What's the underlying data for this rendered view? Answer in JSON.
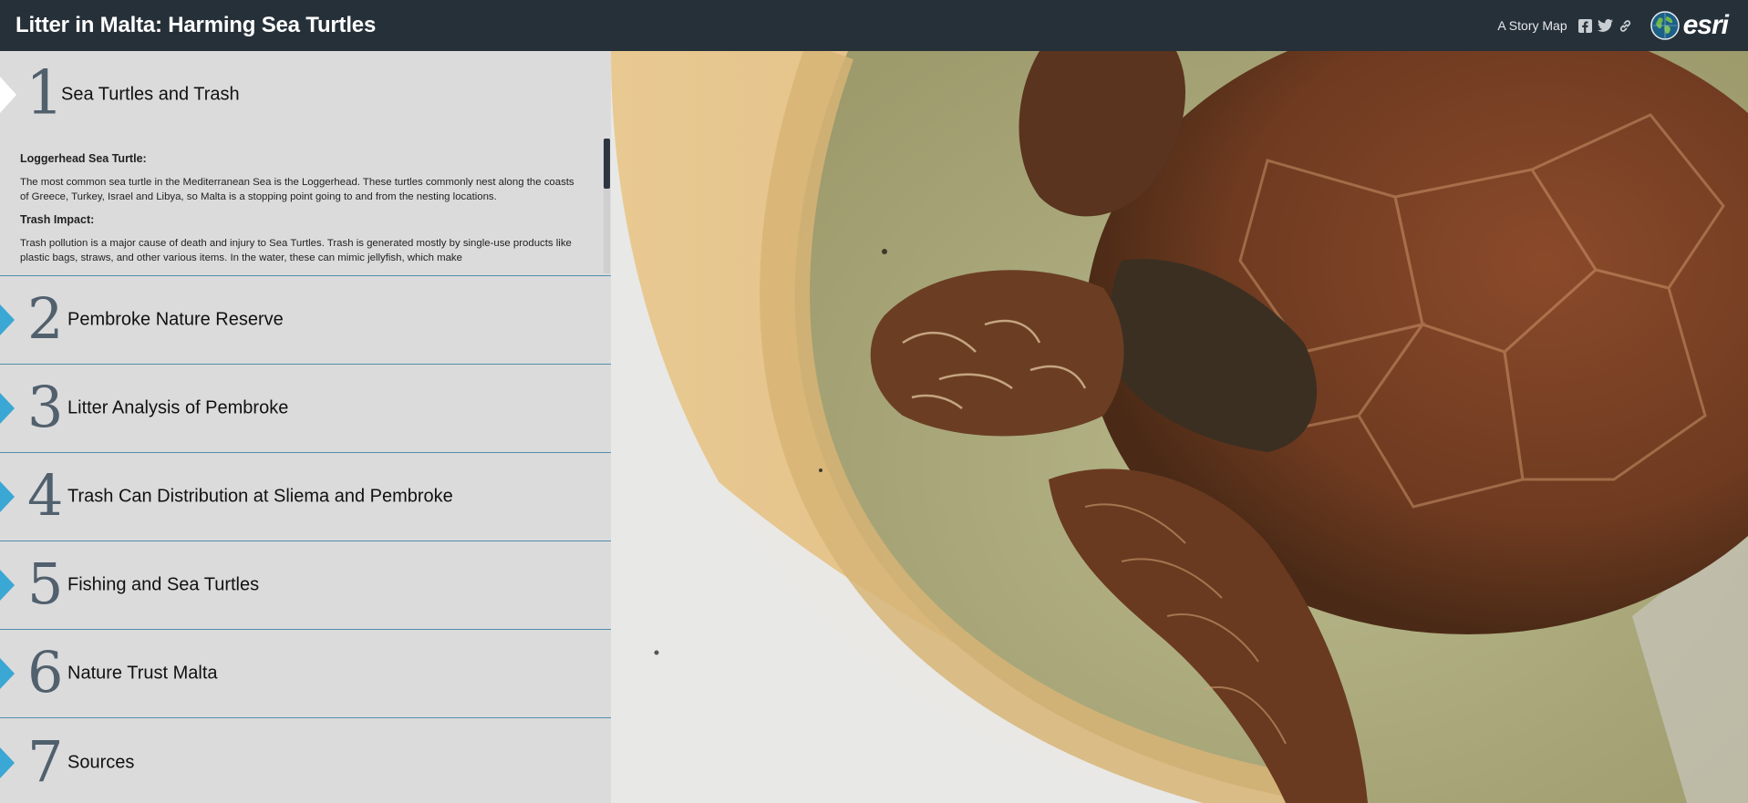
{
  "header": {
    "title": "Litter in Malta: Harming Sea Turtles",
    "story_map_label": "A Story Map",
    "share_icons": [
      "facebook-icon",
      "twitter-icon",
      "link-icon"
    ],
    "logo_text": "esri"
  },
  "sections": [
    {
      "number": "1",
      "label": "Sea Turtles and Trash"
    },
    {
      "number": "2",
      "label": "Pembroke Nature Reserve"
    },
    {
      "number": "3",
      "label": "Litter Analysis of Pembroke"
    },
    {
      "number": "4",
      "label": "Trash Can Distribution at Sliema and Pembroke"
    },
    {
      "number": "5",
      "label": "Fishing and Sea Turtles"
    },
    {
      "number": "6",
      "label": "Nature Trust Malta"
    },
    {
      "number": "7",
      "label": "Sources"
    }
  ],
  "active_content": {
    "heading1": "Loggerhead Sea Turtle:",
    "para1": "The most common sea turtle in the Mediterranean Sea is the Loggerhead. These turtles commonly nest along the coasts of Greece, Turkey, Israel and Libya, so Malta is a stopping point going to and from the nesting locations.",
    "heading2": "Trash Impact:",
    "para2": "Trash pollution is a major cause of death and injury to Sea Turtles. Trash is generated mostly by single-use products like plastic bags, straws, and other various items. In the water, these can mimic jellyfish, which make"
  },
  "colors": {
    "header_bg": "#263039",
    "panel_bg": "#dcdbdc",
    "accent": "#3aa7d4",
    "divider": "#4e8fa9"
  }
}
